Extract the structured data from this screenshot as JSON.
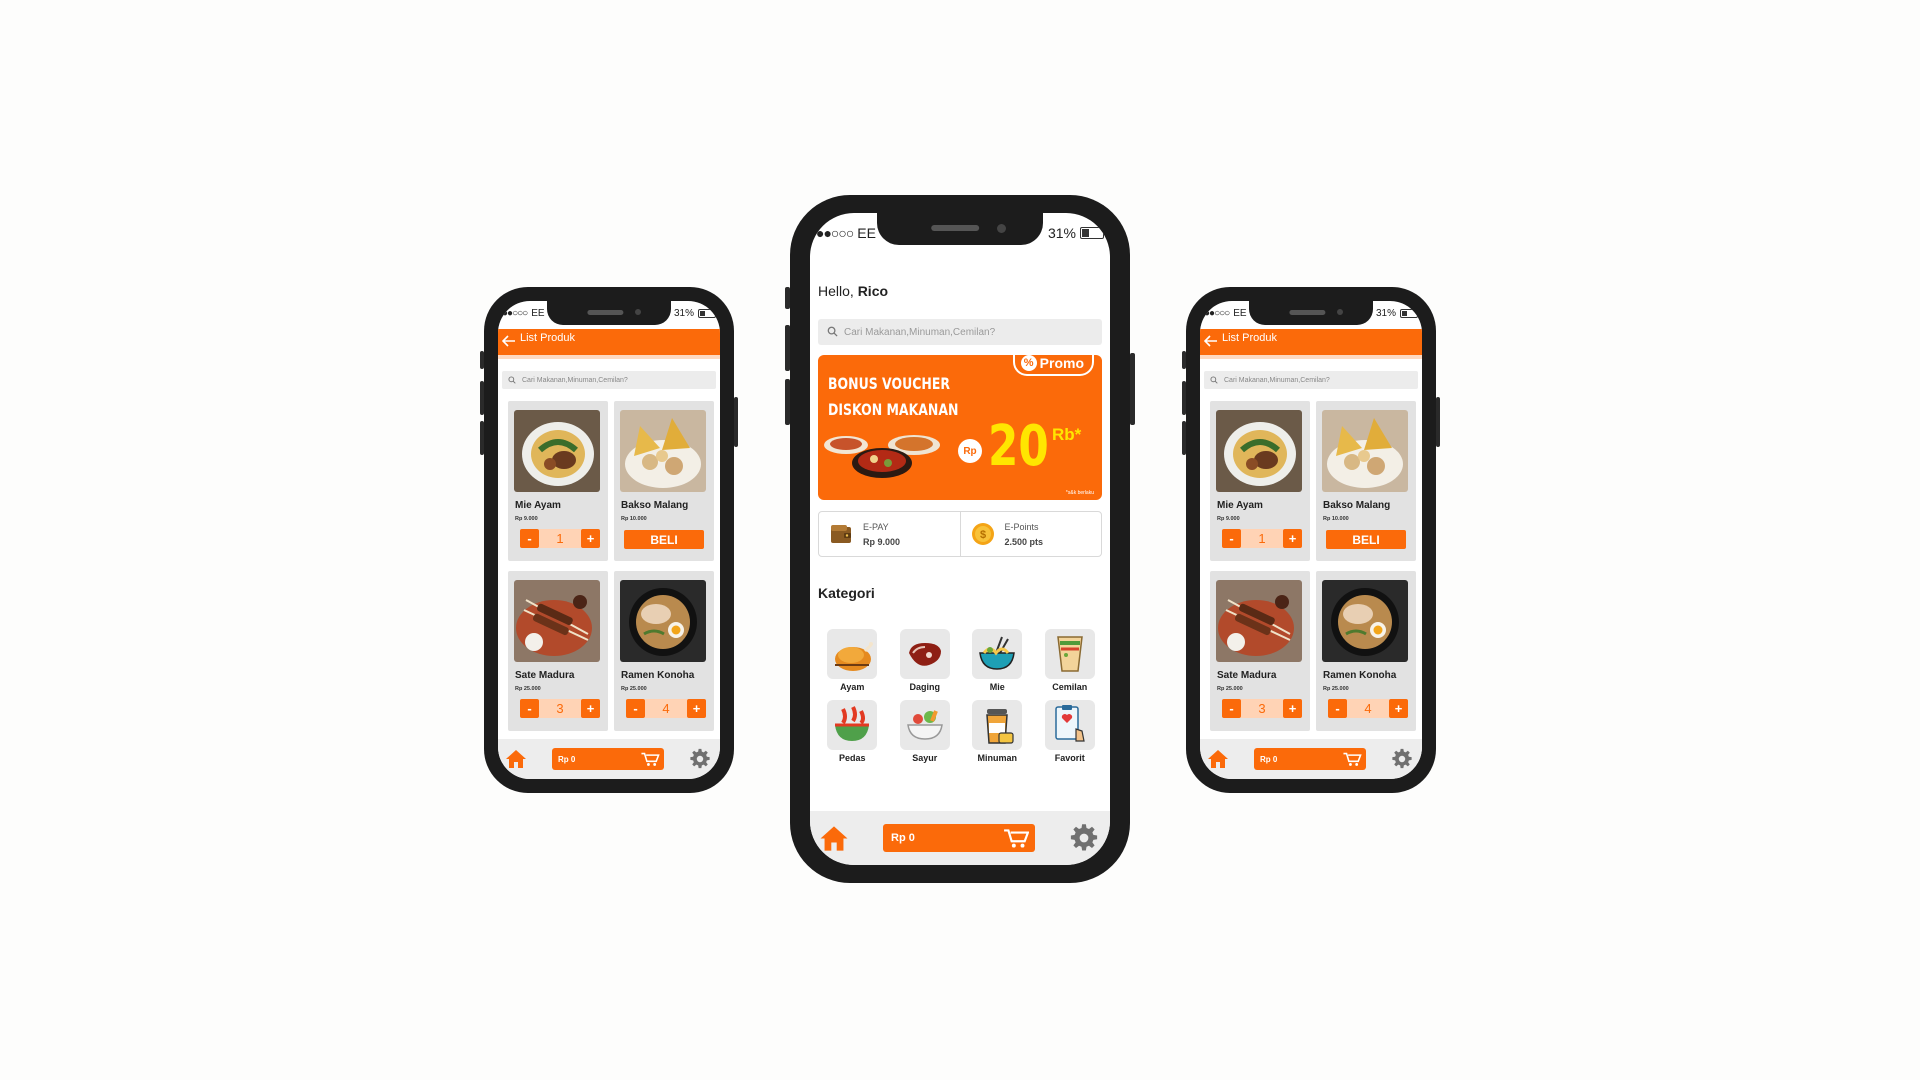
{
  "main": {
    "status": {
      "signal": "●●○○○",
      "carrier": "EE",
      "battery": "31%"
    },
    "greeting_prefix": "Hello,",
    "user_name": "Rico",
    "search_placeholder": "Cari Makanan,Minuman,Cemilan?",
    "promo": {
      "badge": "Promo",
      "badge_symbol": "%",
      "title_line1": "BONUS VOUCHER",
      "title_line2": "DISKON MAKANAN",
      "currency": "Rp",
      "amount": "20",
      "unit": "Rb*",
      "note": "*s&k berlaku"
    },
    "wallet": {
      "epay_label": "E-PAY",
      "epay_value": "Rp 9.000",
      "epoints_label": "E-Points",
      "epoints_value": "2.500 pts"
    },
    "kategori_title": "Kategori",
    "categories": [
      {
        "label": "Ayam",
        "icon": "roast-chicken-icon"
      },
      {
        "label": "Daging",
        "icon": "steak-icon"
      },
      {
        "label": "Mie",
        "icon": "noodle-bowl-icon"
      },
      {
        "label": "Cemilan",
        "icon": "burrito-icon"
      },
      {
        "label": "Pedas",
        "icon": "chili-bowl-icon"
      },
      {
        "label": "Sayur",
        "icon": "vegetable-bowl-icon"
      },
      {
        "label": "Minuman",
        "icon": "coffee-cup-icon"
      },
      {
        "label": "Favorit",
        "icon": "favorite-clipboard-icon"
      }
    ],
    "cart_total": "Rp 0"
  },
  "list_produk": {
    "status": {
      "signal": "●●○○○",
      "carrier": "EE",
      "battery": "31%"
    },
    "title": "List Produk",
    "search_placeholder": "Cari Makanan,Minuman,Cemilan?",
    "products": [
      {
        "name": "Mie Ayam",
        "price": "Rp 9.000",
        "qty": "1",
        "mode": "stepper"
      },
      {
        "name": "Bakso Malang",
        "price": "Rp 10.000",
        "buy_label": "BELI",
        "mode": "buy"
      },
      {
        "name": "Sate Madura",
        "price": "Rp 25.000",
        "qty": "3",
        "mode": "stepper"
      },
      {
        "name": "Ramen Konoha",
        "price": "Rp 25.000",
        "qty": "4",
        "mode": "stepper"
      }
    ],
    "minus_label": "-",
    "plus_label": "+",
    "cart_total": "Rp 0"
  },
  "colors": {
    "accent": "#fb6a0a",
    "accent_light": "#ffd3b5",
    "yellow": "#ffe600",
    "panel": "#ededed"
  }
}
